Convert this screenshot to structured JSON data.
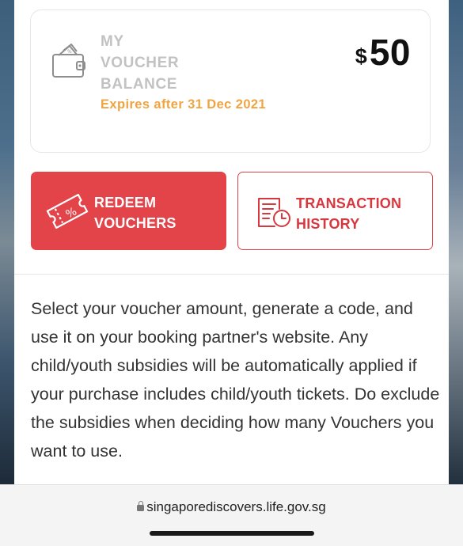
{
  "balance_card": {
    "title_lines": [
      "MY",
      "VOUCHER",
      "BALANCE"
    ],
    "expiry": "Expires after 31 Dec 2021",
    "currency_symbol": "$",
    "amount": "50",
    "icon": "wallet-voucher-icon"
  },
  "actions": {
    "redeem": {
      "line1": "REDEEM",
      "line2": "VOUCHERS",
      "icon": "voucher-ticket-icon"
    },
    "history": {
      "line1": "TRANSACTION",
      "line2": "HISTORY",
      "icon": "document-clock-icon"
    }
  },
  "description": "Select your voucher amount, generate a code, and use it on your booking partner's website. Any child/youth subsidies will be automatically applied if your purchase includes child/youth tickets. Do exclude the subsidies when deciding how many Vouchers you want to use.",
  "browser": {
    "url": "singaporediscovers.life.gov.sg"
  },
  "colors": {
    "accent": "#e2444a",
    "expiry": "#f0a441",
    "muted": "#c2c2c2"
  }
}
